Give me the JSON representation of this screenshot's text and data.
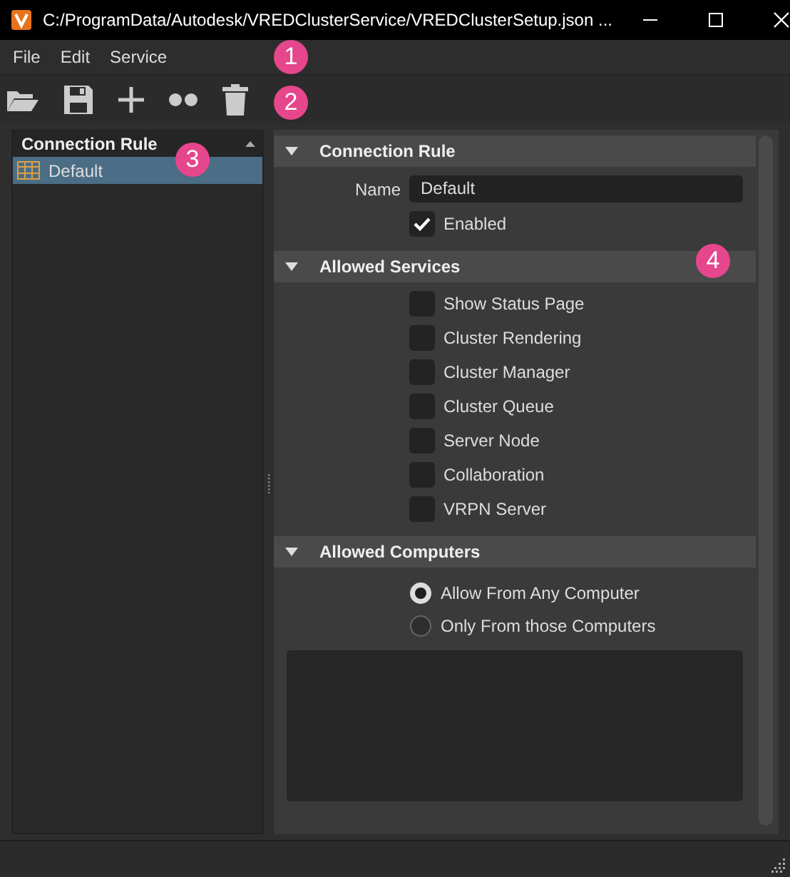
{
  "window": {
    "title": "C:/ProgramData/Autodesk/VREDClusterService/VREDClusterSetup.json ..."
  },
  "menu": [
    "File",
    "Edit",
    "Service"
  ],
  "rules_panel": {
    "header": "Connection Rule",
    "items": [
      {
        "label": "Default",
        "selected": true
      }
    ]
  },
  "connection_rule": {
    "title": "Connection Rule",
    "expanded": true,
    "name_label": "Name",
    "name_value": "Default",
    "enabled": {
      "label": "Enabled",
      "checked": true
    }
  },
  "allowed_services": {
    "title": "Allowed Services",
    "expanded": true,
    "items": [
      {
        "label": "Show Status Page",
        "checked": false
      },
      {
        "label": "Cluster Rendering",
        "checked": false
      },
      {
        "label": "Cluster Manager",
        "checked": false
      },
      {
        "label": "Cluster Queue",
        "checked": false
      },
      {
        "label": "Server Node",
        "checked": false
      },
      {
        "label": "Collaboration",
        "checked": false
      },
      {
        "label": "VRPN Server",
        "checked": false
      }
    ]
  },
  "allowed_computers": {
    "title": "Allowed Computers",
    "expanded": true,
    "options": [
      {
        "label": "Allow From Any Computer",
        "selected": true
      },
      {
        "label": "Only From those Computers",
        "selected": false
      }
    ]
  },
  "callouts": [
    "1",
    "2",
    "3",
    "4"
  ]
}
